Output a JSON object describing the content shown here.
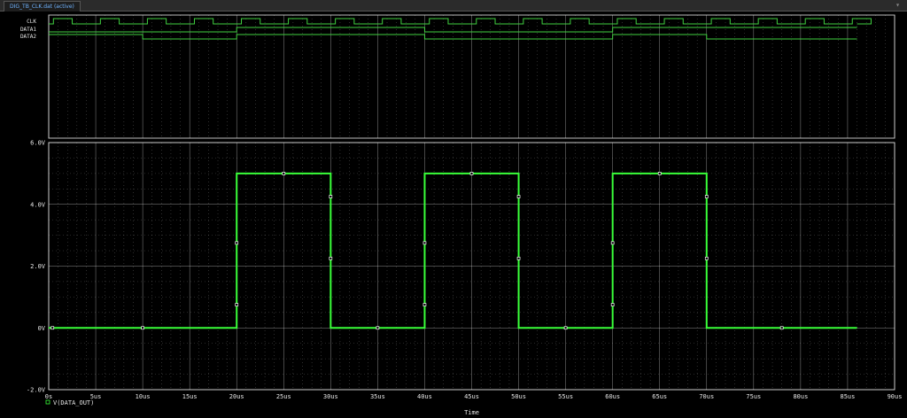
{
  "tab": {
    "title": "DIG_TB_CLK.dat (active)"
  },
  "colors": {
    "background": "#000000",
    "trace": "#39ff39",
    "digital": "#40d040",
    "grid": "#ffffff",
    "marker": "#ffffff"
  },
  "chart_data": {
    "type": "line",
    "digital_signals": [
      {
        "name": "CLK"
      },
      {
        "name": "DATA1"
      },
      {
        "name": "DATA2"
      }
    ],
    "x_ticks": [
      "0s",
      "5us",
      "10us",
      "15us",
      "20us",
      "25us",
      "30us",
      "35us",
      "40us",
      "45us",
      "50us",
      "55us",
      "60us",
      "65us",
      "70us",
      "75us",
      "80us",
      "85us",
      "90us"
    ],
    "y_ticks": [
      "6.0V",
      "4.0V",
      "2.0V",
      "0V",
      "-2.0V"
    ],
    "xlabel": "Time",
    "xlim": [
      0,
      90
    ],
    "ylim": [
      -2,
      6
    ],
    "grid": true,
    "series": [
      {
        "name": "V(DATA_OUT)",
        "x": [
          0,
          20,
          20,
          30,
          30,
          40,
          40,
          50,
          50,
          60,
          60,
          70,
          70,
          86
        ],
        "y": [
          0,
          0,
          5,
          5,
          0,
          0,
          5,
          5,
          0,
          0,
          5,
          5,
          0,
          0
        ]
      }
    ]
  }
}
